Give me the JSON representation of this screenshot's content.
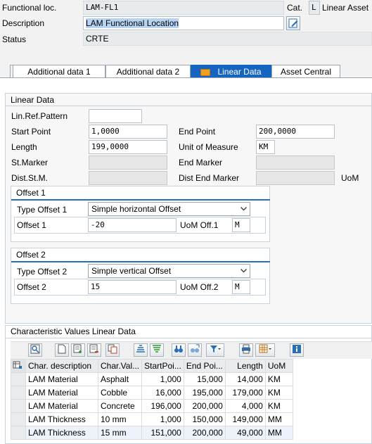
{
  "header": {
    "functional_loc_label": "Functional loc.",
    "functional_loc_value": "LAM-FL1",
    "cat_label": "Cat.",
    "cat_value": "L",
    "cat_text": "Linear Asset",
    "description_label": "Description",
    "description_value": "LAM Functional Location",
    "status_label": "Status",
    "status_value": "CRTE"
  },
  "tabs": [
    {
      "label": "Additional data 1"
    },
    {
      "label": "Additional data 2"
    },
    {
      "label": "Linear Data",
      "active": true
    },
    {
      "label": "Asset Central"
    }
  ],
  "linear": {
    "title": "Linear Data",
    "lin_ref_pattern_label": "Lin.Ref.Pattern",
    "lin_ref_pattern_value": "",
    "start_point_label": "Start Point",
    "start_point_value": "1,0000",
    "end_point_label": "End Point",
    "end_point_value": "200,0000",
    "length_label": "Length",
    "length_value": "199,0000",
    "uom_label": "Unit of Measure",
    "uom_value": "KM",
    "st_marker_label": "St.Marker",
    "end_marker_label": "End Marker",
    "dist_st_m_label": "Dist.St.M.",
    "dist_end_marker_label": "Dist End Marker",
    "uom_short": "UoM"
  },
  "offset1": {
    "title": "Offset 1",
    "type_label": "Type Offset 1",
    "type_value": "Simple horizontal Offset",
    "offset_label": "Offset 1",
    "offset_value": "-20",
    "uom_label": "UoM Off.1",
    "uom_value": "M"
  },
  "offset2": {
    "title": "Offset 2",
    "type_label": "Type Offset 2",
    "type_value": "Simple vertical Offset",
    "offset_label": "Offset 2",
    "offset_value": "15",
    "uom_label": "UoM Off.2",
    "uom_value": "M"
  },
  "char_section": {
    "title": "Characteristic Values Linear Data",
    "columns": [
      "Char. description",
      "Char.Val...",
      "StartPoi...",
      "End Poi...",
      "Length",
      "UoM"
    ],
    "rows": [
      [
        "LAM Material",
        "Asphalt",
        "1,000",
        "15,000",
        "14,000",
        "KM"
      ],
      [
        "LAM Material",
        "Cobble",
        "16,000",
        "195,000",
        "179,000",
        "KM"
      ],
      [
        "LAM Material",
        "Concrete",
        "196,000",
        "200,000",
        "4,000",
        "KM"
      ],
      [
        "LAM Thickness",
        "10 mm",
        "1,000",
        "150,000",
        "149,000",
        "MM"
      ],
      [
        "LAM Thickness",
        "15 mm",
        "151,000",
        "200,000",
        "49,000",
        "MM"
      ]
    ]
  },
  "colors": {
    "accent": "#1565c0",
    "active_tab": "#1565c0",
    "description_highlight": "#b7d3f2"
  }
}
